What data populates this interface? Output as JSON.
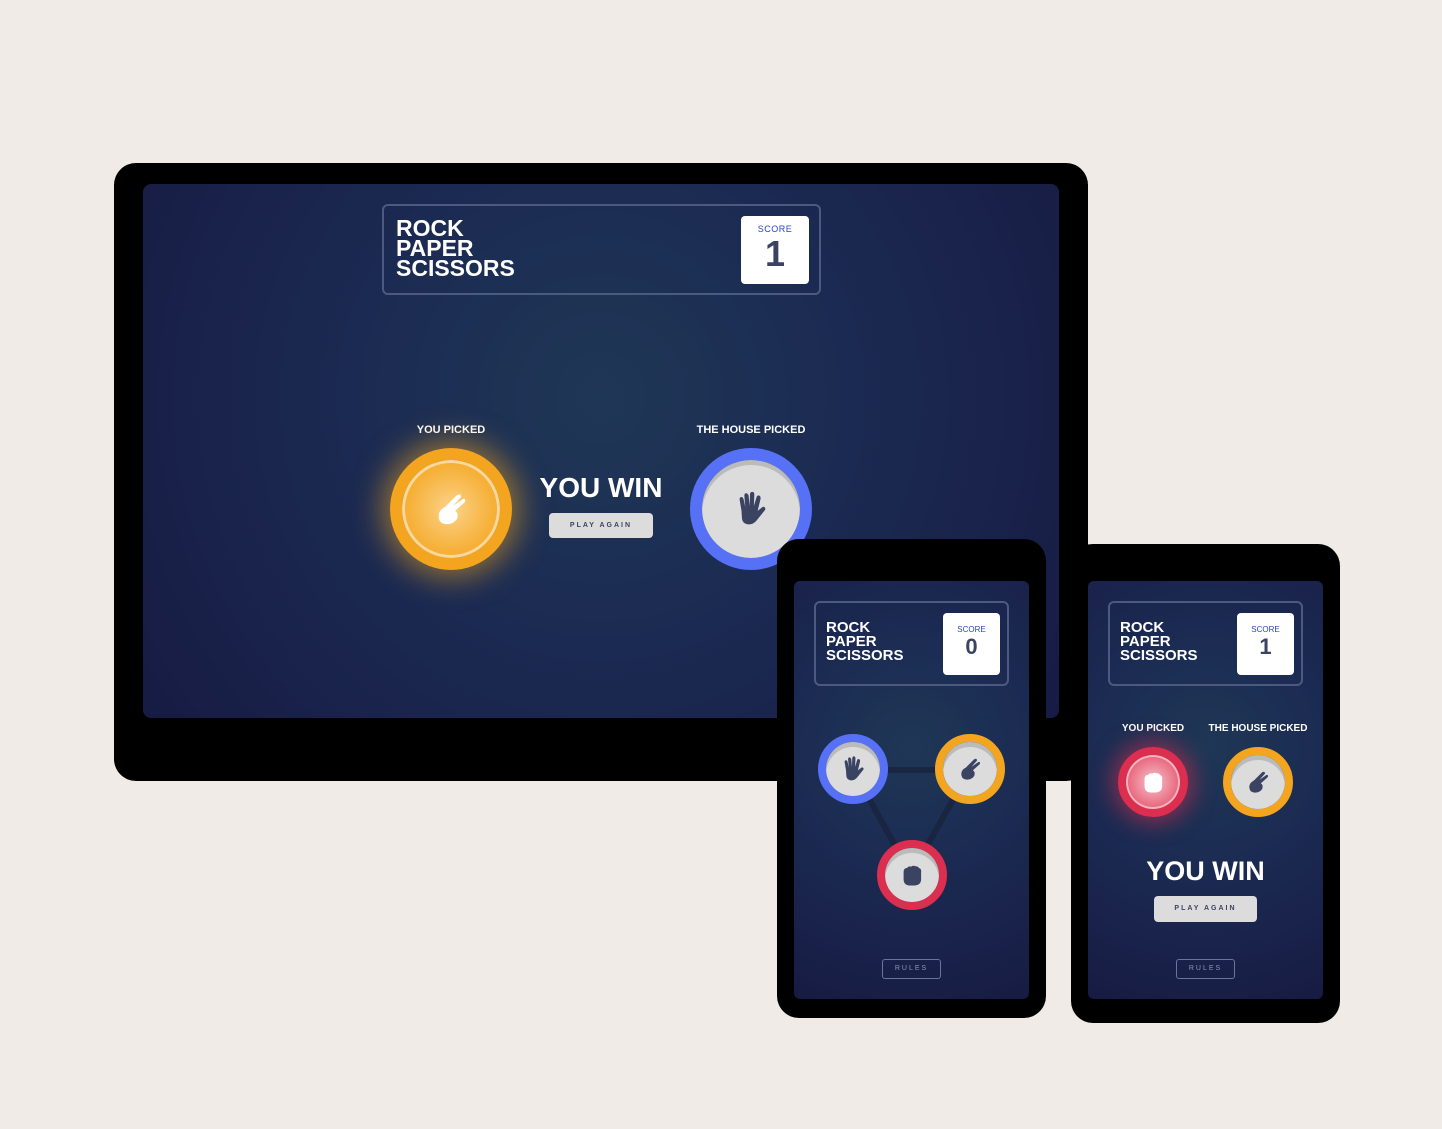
{
  "game": {
    "title_lines": [
      "ROCK",
      "PAPER",
      "SCISSORS"
    ],
    "score_label": "SCORE",
    "you_picked_label": "YOU PICKED",
    "house_picked_label": "THE HOUSE PICKED",
    "play_again_label": "PLAY AGAIN",
    "rules_label": "RULES"
  },
  "desktop": {
    "score": "1",
    "player_choice": "scissors",
    "house_choice": "paper",
    "result": "YOU WIN"
  },
  "mobile_select": {
    "score": "0",
    "options": [
      "paper",
      "scissors",
      "rock"
    ]
  },
  "mobile_result": {
    "score": "1",
    "player_choice": "rock",
    "house_choice": "scissors",
    "result": "YOU WIN"
  },
  "colors": {
    "scissors": "#f3a51f",
    "paper": "#5671f5",
    "rock": "#dc2e4e",
    "background": "#f0ebe7",
    "screen_dark": "#171b43",
    "icon_dark": "#3b4363"
  },
  "icons": {
    "scissors": "scissors-hand-icon",
    "paper": "paper-hand-icon",
    "rock": "rock-fist-icon"
  }
}
